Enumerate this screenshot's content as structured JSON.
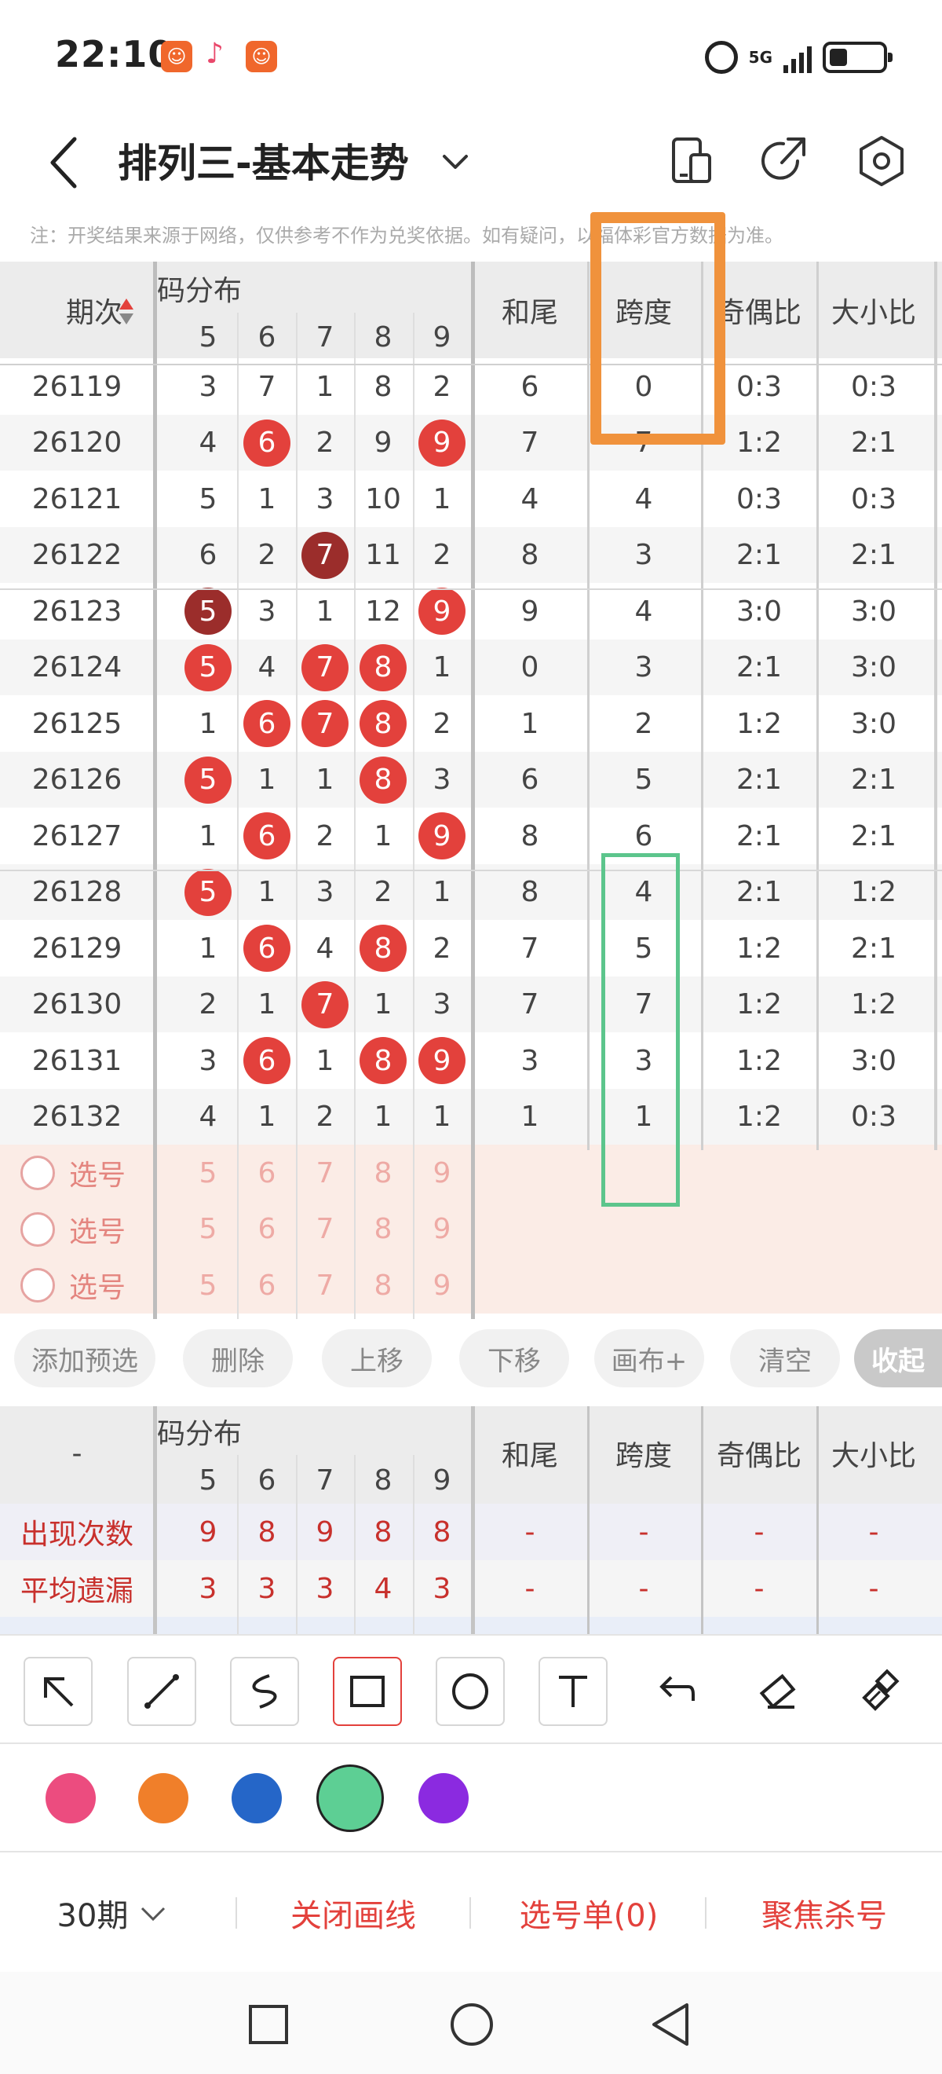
{
  "status": {
    "time": "22:10",
    "network": "5G"
  },
  "header": {
    "title": "排列三-基本走势"
  },
  "notice": "注：开奖结果来源于网络，仅供参考不作为兑奖依据。如有疑问，以福体彩官方数据为准。",
  "table": {
    "col_period": "期次",
    "col_dist": "号码分布",
    "digits": [
      "5",
      "6",
      "7",
      "8",
      "9"
    ],
    "col_sum_tail": "和尾",
    "col_span": "跨度",
    "col_odd_even": "奇偶比",
    "col_big_small": "大小比",
    "rows": [
      {
        "period": "26119",
        "d": [
          "3",
          "7",
          "1",
          "8",
          "2"
        ],
        "balls": [],
        "tail": "6",
        "span": "0",
        "oe": "0:3",
        "bs": "0:3"
      },
      {
        "period": "26120",
        "d": [
          "4",
          "6",
          "2",
          "9",
          "9"
        ],
        "balls": [
          1,
          4
        ],
        "tail": "7",
        "span": "7",
        "oe": "1:2",
        "bs": "2:1"
      },
      {
        "period": "26121",
        "d": [
          "5",
          "1",
          "3",
          "10",
          "1"
        ],
        "balls": [],
        "tail": "4",
        "span": "4",
        "oe": "0:3",
        "bs": "0:3"
      },
      {
        "period": "26122",
        "d": [
          "6",
          "2",
          "7",
          "11",
          "2"
        ],
        "balls": [
          2
        ],
        "dark": [
          2
        ],
        "tail": "8",
        "span": "3",
        "oe": "2:1",
        "bs": "2:1"
      },
      {
        "period": "26123",
        "d": [
          "5",
          "3",
          "1",
          "12",
          "9"
        ],
        "balls": [
          0,
          4
        ],
        "dark": [
          0
        ],
        "tail": "9",
        "span": "4",
        "oe": "3:0",
        "bs": "3:0"
      },
      {
        "period": "26124",
        "d": [
          "5",
          "4",
          "7",
          "8",
          "1"
        ],
        "balls": [
          0,
          2,
          3
        ],
        "tail": "0",
        "span": "3",
        "oe": "2:1",
        "bs": "3:0"
      },
      {
        "period": "26125",
        "d": [
          "1",
          "6",
          "7",
          "8",
          "2"
        ],
        "balls": [
          1,
          2,
          3
        ],
        "tail": "1",
        "span": "2",
        "oe": "1:2",
        "bs": "3:0"
      },
      {
        "period": "26126",
        "d": [
          "5",
          "1",
          "1",
          "8",
          "3"
        ],
        "balls": [
          0,
          3
        ],
        "tail": "6",
        "span": "5",
        "oe": "2:1",
        "bs": "2:1"
      },
      {
        "period": "26127",
        "d": [
          "1",
          "6",
          "2",
          "1",
          "9"
        ],
        "balls": [
          1,
          4
        ],
        "tail": "8",
        "span": "6",
        "oe": "2:1",
        "bs": "2:1"
      },
      {
        "period": "26128",
        "d": [
          "5",
          "1",
          "3",
          "2",
          "1"
        ],
        "balls": [
          0
        ],
        "tail": "8",
        "span": "4",
        "oe": "2:1",
        "bs": "1:2"
      },
      {
        "period": "26129",
        "d": [
          "1",
          "6",
          "4",
          "8",
          "2"
        ],
        "balls": [
          1,
          3
        ],
        "tail": "7",
        "span": "5",
        "oe": "1:2",
        "bs": "2:1"
      },
      {
        "period": "26130",
        "d": [
          "2",
          "1",
          "7",
          "1",
          "3"
        ],
        "balls": [
          2
        ],
        "tail": "7",
        "span": "7",
        "oe": "1:2",
        "bs": "1:2"
      },
      {
        "period": "26131",
        "d": [
          "3",
          "6",
          "1",
          "8",
          "9"
        ],
        "balls": [
          1,
          3,
          4
        ],
        "tail": "3",
        "span": "3",
        "oe": "1:2",
        "bs": "3:0"
      },
      {
        "period": "26132",
        "d": [
          "4",
          "1",
          "2",
          "1",
          "1"
        ],
        "balls": [],
        "tail": "1",
        "span": "1",
        "oe": "1:2",
        "bs": "0:3"
      }
    ],
    "pick_label": "选号",
    "pick_digits": [
      "5",
      "6",
      "7",
      "8",
      "9"
    ]
  },
  "actions": {
    "add": "添加预选",
    "delete": "删除",
    "up": "上移",
    "down": "下移",
    "draw_plus": "画布+",
    "clear": "清空",
    "collapse": "收起"
  },
  "stats": {
    "dash": "-",
    "appear_label": "出现次数",
    "appear": [
      "9",
      "8",
      "9",
      "8",
      "8"
    ],
    "avg_label": "平均遗漏",
    "avg": [
      "3",
      "3",
      "3",
      "4",
      "3"
    ]
  },
  "colors": {
    "accent": "#e3413c",
    "orange_box": "#f0923c",
    "green_box": "#5cc58c",
    "swatches": [
      "#ec4c7f",
      "#f07f2a",
      "#2566c8",
      "#5dcf94",
      "#8b2ae0"
    ]
  },
  "bottom": {
    "periods": "30期",
    "close_lines": "关闭画线",
    "pick_list": "选号单(0)",
    "focus_kill": "聚焦杀号"
  }
}
